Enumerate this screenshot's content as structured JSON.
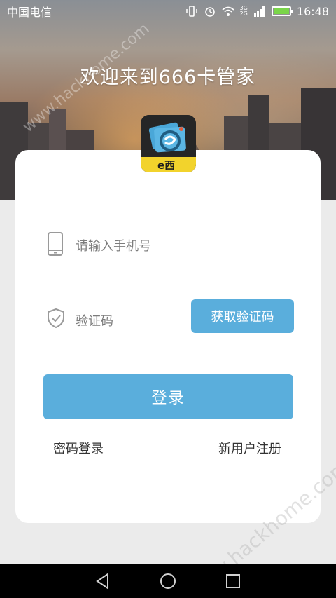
{
  "status_bar": {
    "carrier": "中国电信",
    "network": [
      "3G",
      "2G"
    ],
    "time": "16:48"
  },
  "header": {
    "welcome": "欢迎来到666卡管家"
  },
  "app_logo": {
    "badge_text": "e西"
  },
  "login_form": {
    "phone_placeholder": "请输入手机号",
    "code_placeholder": "验证码",
    "get_code_label": "获取验证码",
    "login_label": "登录",
    "password_login_label": "密码登录",
    "register_label": "新用户注册"
  },
  "watermark": {
    "text": "www.hackhome.com"
  },
  "colors": {
    "accent": "#5aaedc",
    "card": "#ffffff",
    "background": "#ebebeb"
  },
  "icons": [
    "phone-icon",
    "shield-check-icon",
    "back-icon",
    "home-icon",
    "recents-icon"
  ]
}
